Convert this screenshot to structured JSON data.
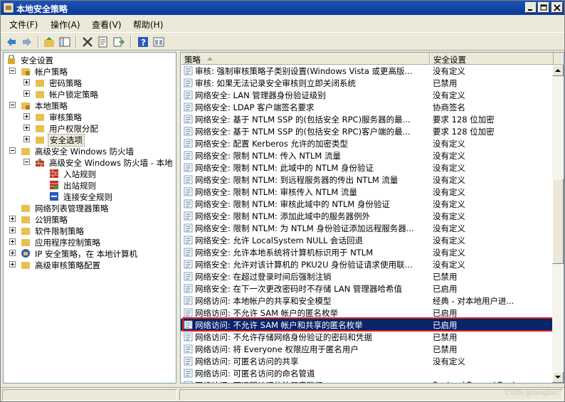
{
  "window": {
    "title": "本地安全策略"
  },
  "menu": [
    "文件(F)",
    "操作(A)",
    "查看(V)",
    "帮助(H)"
  ],
  "toolbar": [
    "back-icon",
    "forward-icon",
    "up-folder-icon",
    "show-tree-icon",
    "delete-icon",
    "properties-icon",
    "export-icon",
    "help-icon",
    "console-icon"
  ],
  "tree": {
    "root": "安全设置",
    "items": [
      {
        "label": "帐户策略"
      },
      {
        "label": "密码策略"
      },
      {
        "label": "帐户锁定策略"
      },
      {
        "label": "本地策略"
      },
      {
        "label": "审核策略"
      },
      {
        "label": "用户权限分配"
      },
      {
        "label": "安全选项"
      },
      {
        "label": "高级安全 Windows 防火墙"
      },
      {
        "label": "高级安全 Windows 防火墙 - 本地"
      },
      {
        "label": "入站规则"
      },
      {
        "label": "出站规则"
      },
      {
        "label": "连接安全规则"
      },
      {
        "label": "网络列表管理器策略"
      },
      {
        "label": "公钥策略"
      },
      {
        "label": "软件限制策略"
      },
      {
        "label": "应用程序控制策略"
      },
      {
        "label": "IP 安全策略，在 本地计算机"
      },
      {
        "label": "高级审核策略配置"
      }
    ]
  },
  "list": {
    "headers": {
      "policy": "策略",
      "setting": "安全设置"
    },
    "rows": [
      {
        "policy": "审核: 强制审核策略子类别设置(Windows Vista 或更高版...",
        "setting": "没有定义"
      },
      {
        "policy": "审核: 如果无法记录安全审核则立即关闭系统",
        "setting": "已禁用"
      },
      {
        "policy": "网络安全: LAN 管理器身份验证级别",
        "setting": "没有定义"
      },
      {
        "policy": "网络安全: LDAP 客户端签名要求",
        "setting": "协商签名"
      },
      {
        "policy": "网络安全: 基于 NTLM SSP 的(包括安全 RPC)服务器的最...",
        "setting": "要求 128 位加密"
      },
      {
        "policy": "网络安全: 基于 NTLM SSP 的(包括安全 RPC)客户端的最...",
        "setting": "要求 128 位加密"
      },
      {
        "policy": "网络安全: 配置 Kerberos 允许的加密类型",
        "setting": "没有定义"
      },
      {
        "policy": "网络安全: 限制 NTLM: 传入 NTLM 流量",
        "setting": "没有定义"
      },
      {
        "policy": "网络安全: 限制 NTLM: 此域中的 NTLM 身份验证",
        "setting": "没有定义"
      },
      {
        "policy": "网络安全: 限制 NTLM: 到远程服务器的传出 NTLM 流量",
        "setting": "没有定义"
      },
      {
        "policy": "网络安全: 限制 NTLM: 审核传入 NTLM 流量",
        "setting": "没有定义"
      },
      {
        "policy": "网络安全: 限制 NTLM: 审核此域中的 NTLM 身份验证",
        "setting": "没有定义"
      },
      {
        "policy": "网络安全: 限制 NTLM: 添加此域中的服务器例外",
        "setting": "没有定义"
      },
      {
        "policy": "网络安全: 限制 NTLM: 为 NTLM 身份验证添加远程服务器...",
        "setting": "没有定义"
      },
      {
        "policy": "网络安全: 允许 LocalSystem NULL 会话回退",
        "setting": "没有定义"
      },
      {
        "policy": "网络安全: 允许本地系统将计算机标识用于 NTLM",
        "setting": "没有定义"
      },
      {
        "policy": "网络安全: 允许对该计算机的 PKU2U 身份验证请求使用联...",
        "setting": "没有定义"
      },
      {
        "policy": "网络安全: 在超过登录时间后强制注销",
        "setting": "已禁用"
      },
      {
        "policy": "网络安全: 在下一次更改密码时不存储 LAN 管理器哈希值",
        "setting": "已启用"
      },
      {
        "policy": "网络访问: 本地帐户的共享和安全模型",
        "setting": "经典 - 对本地用户进..."
      },
      {
        "policy": "网络访问: 不允许 SAM 帐户的匿名枚举",
        "setting": "已启用"
      },
      {
        "policy": "网络访问: 不允许 SAM 帐户和共享的匿名枚举",
        "setting": "已启用",
        "selected": true
      },
      {
        "policy": "网络访问: 不允许存储网络身份验证的密码和凭据",
        "setting": "已禁用"
      },
      {
        "policy": "网络访问: 将 Everyone 权限应用于匿名用户",
        "setting": "已禁用"
      },
      {
        "policy": "网络访问: 可匿名访问的共享",
        "setting": "没有定义"
      },
      {
        "policy": "网络访问: 可匿名访问的命名管道",
        "setting": ""
      },
      {
        "policy": "网络访问: 可远程访问的注册表路径",
        "setting": "System\\CurrentContro..."
      }
    ]
  },
  "watermark": "CSDN @zengbac"
}
